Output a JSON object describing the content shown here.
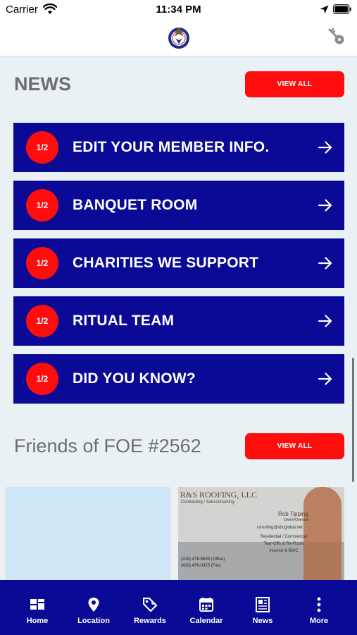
{
  "status_bar": {
    "carrier": "Carrier",
    "time": "11:34 PM"
  },
  "header": {
    "logo": "foe-eagle-logo-icon",
    "key": "key-icon"
  },
  "news": {
    "title": "NEWS",
    "view_all": "VIEW ALL",
    "items": [
      {
        "badge": "1/2",
        "label": "EDIT YOUR MEMBER INFO."
      },
      {
        "badge": "1/2",
        "label": "BANQUET ROOM"
      },
      {
        "badge": "1/2",
        "label": "CHARITIES WE SUPPORT"
      },
      {
        "badge": "1/2",
        "label": "RITUAL TEAM"
      },
      {
        "badge": "1/2",
        "label": "DID YOU KNOW?"
      }
    ]
  },
  "friends": {
    "title": "Friends of FOE #2562",
    "view_all": "VIEW ALL",
    "card": {
      "name": "R&S ROOFING, LLC",
      "subtitle": "Contracting / Subcontracting",
      "owner": "Rob Tipping",
      "role": "Owner/Operator",
      "email": "rsroofing@sbcglobal.net",
      "services": [
        "Residential / Commercial",
        "Tear-Offs & Re-Roofs",
        "Insured & BWC"
      ],
      "phones": [
        "(419) 476-6699 (Office)",
        "(419) 476-0925 (Fax)"
      ]
    }
  },
  "tabs": [
    {
      "label": "Home",
      "icon": "home-grid-icon"
    },
    {
      "label": "Location",
      "icon": "location-pin-icon"
    },
    {
      "label": "Rewards",
      "icon": "rewards-tag-icon"
    },
    {
      "label": "Calendar",
      "icon": "calendar-icon"
    },
    {
      "label": "News",
      "icon": "news-icon"
    },
    {
      "label": "More",
      "icon": "more-dots-icon"
    }
  ],
  "colors": {
    "brand_blue": "#0a0a96",
    "accent_red": "#ff0d0d",
    "background": "#eaf1f5"
  }
}
